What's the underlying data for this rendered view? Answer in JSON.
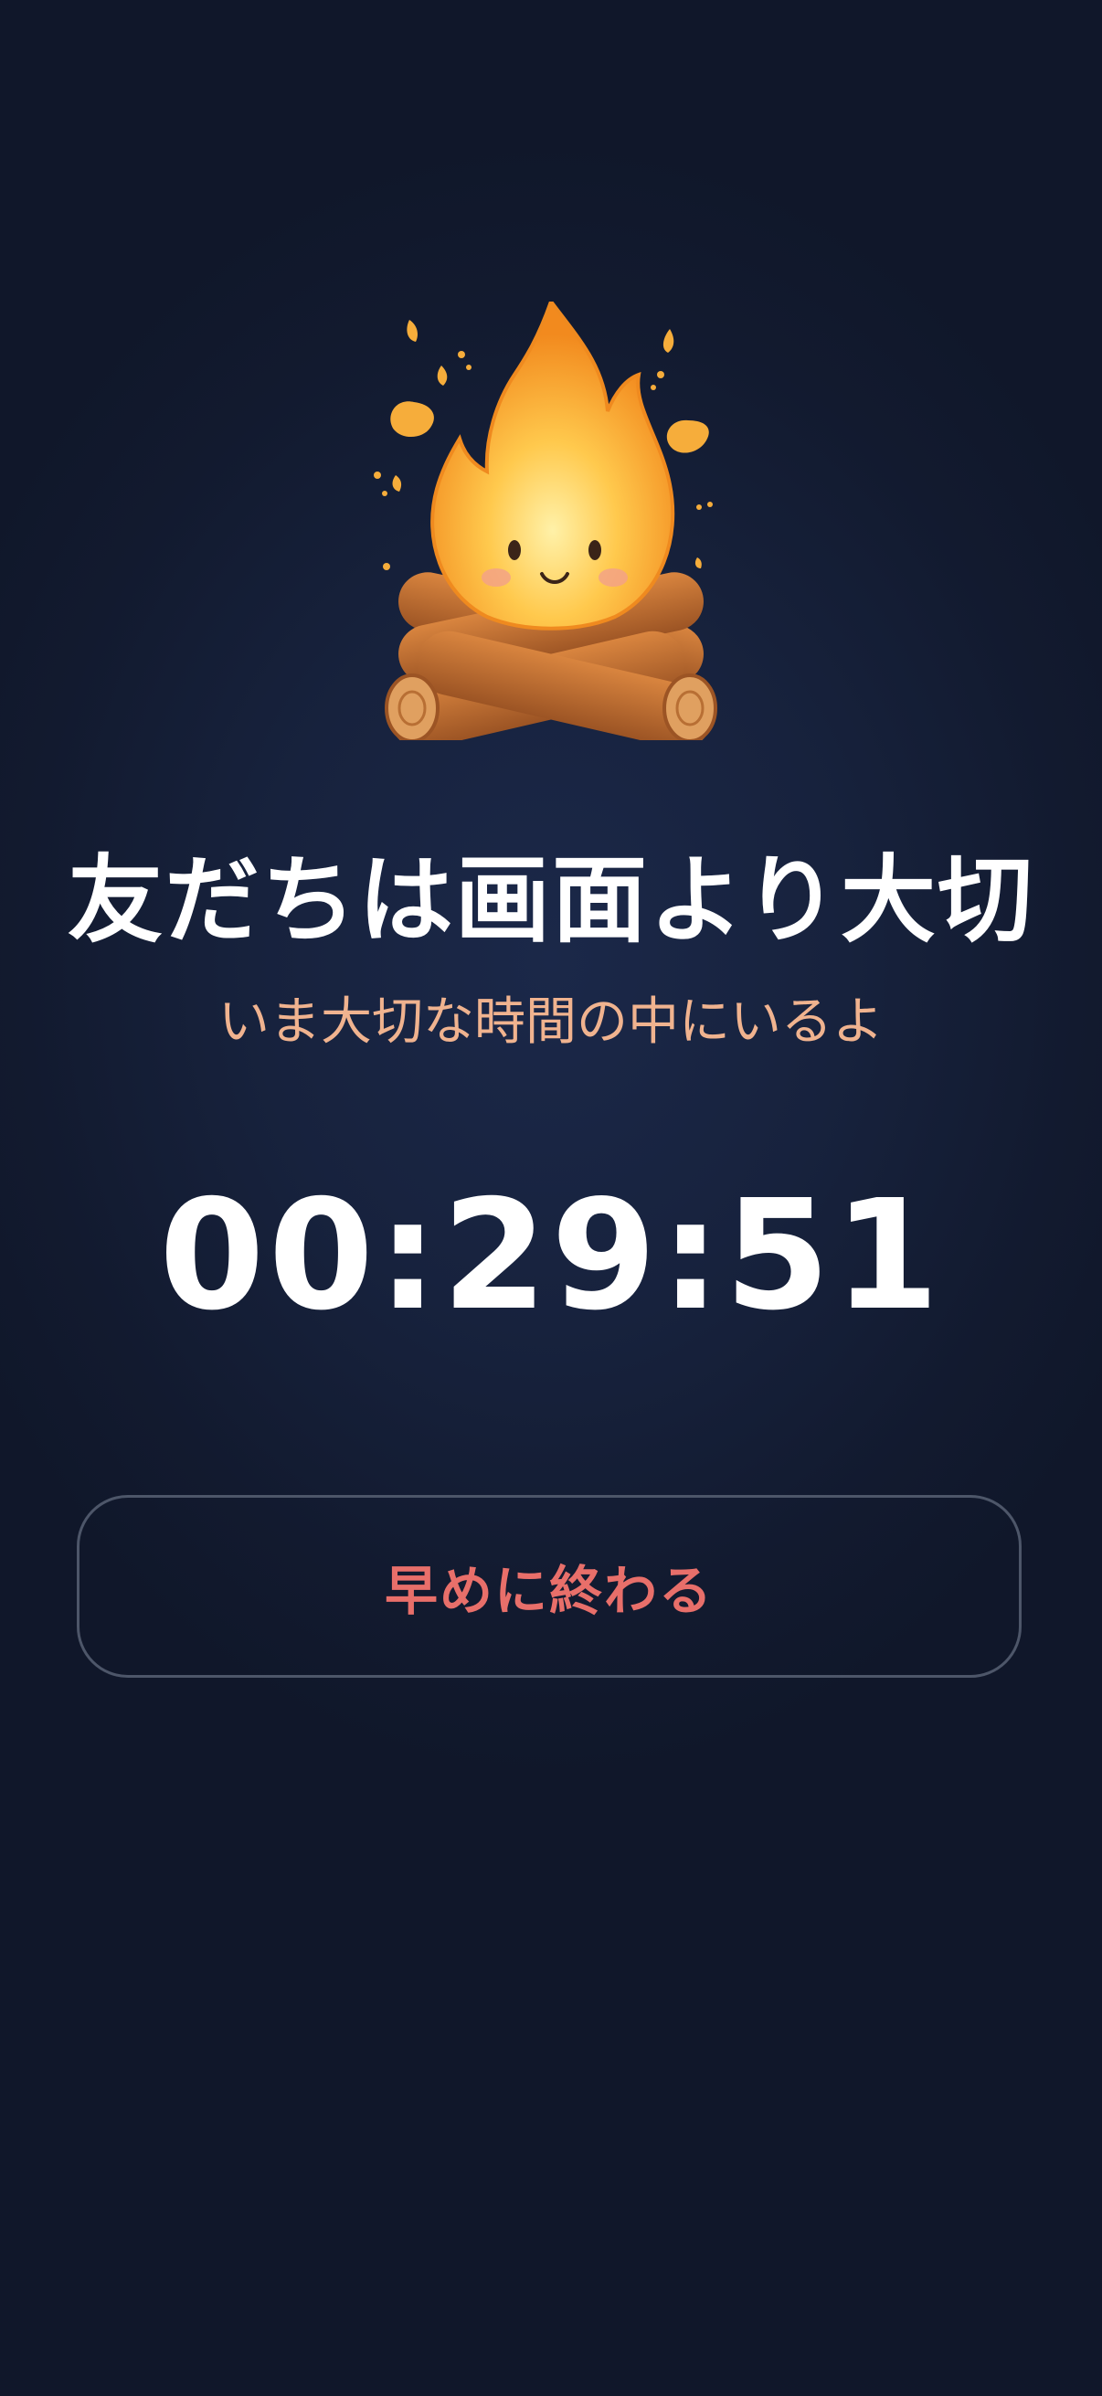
{
  "screen": {
    "title": "友だちは画面より大切",
    "subtitle": "いま大切な時間の中にいるよ",
    "timer": "00:29:51",
    "end_button_label": "早めに終わる",
    "mascot_icon": "campfire-mascot-icon"
  },
  "colors": {
    "background": "#141d34",
    "title": "#ffffff",
    "subtitle": "#f0b38f",
    "timer": "#ffffff",
    "button_text": "#e86f6a",
    "button_border": "#4d5669"
  }
}
